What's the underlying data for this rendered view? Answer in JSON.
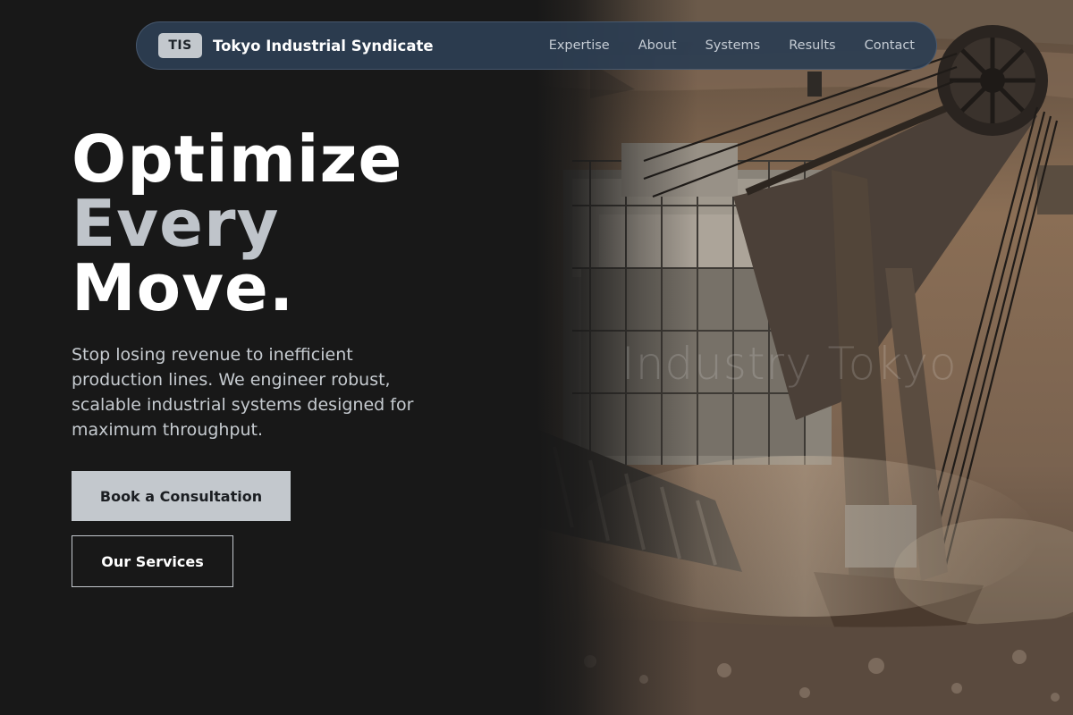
{
  "nav": {
    "badge": "TIS",
    "brand": "Tokyo Industrial Syndicate",
    "links": [
      "Expertise",
      "About",
      "Systems",
      "Results",
      "Contact"
    ]
  },
  "hero": {
    "headline": [
      "Optimize",
      "Every",
      "Move."
    ],
    "subtext": "Stop losing revenue to inefficient production lines. We engineer robust, scalable industrial systems designed for maximum throughput.",
    "primary_cta": "Book a Consultation",
    "secondary_cta": "Our Services",
    "image_watermark": "Industry Tokyo",
    "image_subject": "mining-excavator-photo"
  },
  "colors": {
    "background": "#181818",
    "nav_bg": "#2d3e52",
    "accent_gray": "#c3c8cd",
    "headline_secondary": "#bfc4ca"
  }
}
